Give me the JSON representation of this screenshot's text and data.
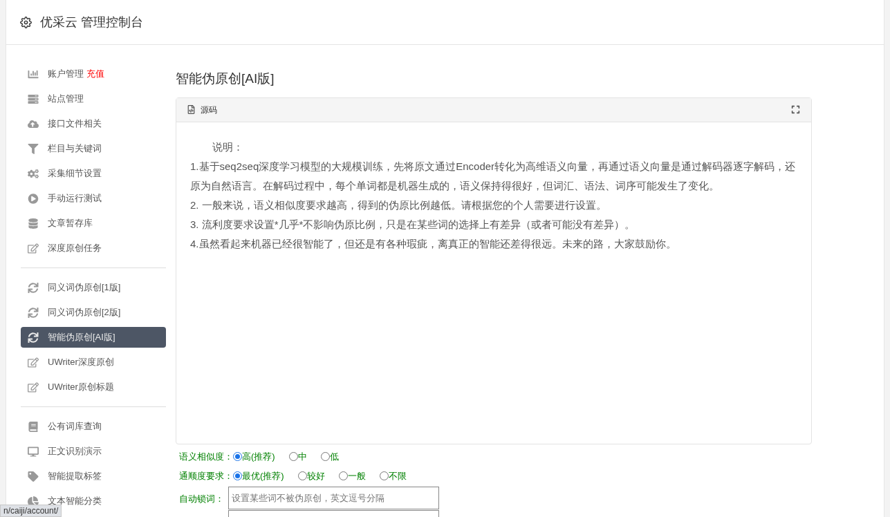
{
  "header": {
    "title": "优采云 管理控制台"
  },
  "sidebar": {
    "groups": [
      {
        "items": [
          {
            "label": "账户管理",
            "badge": "充值",
            "selected": false
          },
          {
            "label": "站点管理",
            "selected": false
          },
          {
            "label": "接口文件相关",
            "selected": false
          },
          {
            "label": "栏目与关键词",
            "selected": false
          },
          {
            "label": "采集细节设置",
            "selected": false
          },
          {
            "label": "手动运行测试",
            "selected": false
          },
          {
            "label": "文章暂存库",
            "selected": false
          },
          {
            "label": "深度原创任务",
            "selected": false
          }
        ]
      },
      {
        "items": [
          {
            "label": "同义词伪原创[1版]",
            "selected": false
          },
          {
            "label": "同义词伪原创[2版]",
            "selected": false
          },
          {
            "label": "智能伪原创[AI版]",
            "selected": true
          },
          {
            "label": "UWriter深度原创",
            "selected": false
          },
          {
            "label": "UWriter原创标题",
            "selected": false
          }
        ]
      },
      {
        "items": [
          {
            "label": "公有词库查询",
            "selected": false
          },
          {
            "label": "正文识别演示",
            "selected": false
          },
          {
            "label": "智能提取标签",
            "selected": false
          },
          {
            "label": "文本智能分类",
            "selected": false
          }
        ]
      }
    ]
  },
  "main": {
    "title": "智能伪原创[AI版]",
    "card": {
      "tab": "源码",
      "heading": "说明：",
      "notes": [
        "1.基于seq2seq深度学习模型的大规模训练，先将原文通过Encoder转化为高维语义向量，再通过语义向量是通过解码器逐字解码，还原为自然语言。在解码过程中，每个单词都是机器生成的，语义保持得很好，但词汇、语法、词序可能发生了变化。",
        "2. 一般来说，语义相似度要求越高，得到的伪原比例越低。请根据您的个人需要进行设置。",
        "3. 流利度要求设置*几乎*不影响伪原比例，只是在某些词的选择上有差异（或者可能没有差异）。",
        "4.虽然看起来机器已经很智能了，但还是有各种瑕疵，离真正的智能还差得很远。未来的路，大家鼓励你。"
      ]
    },
    "form": [
      {
        "kind": "radio",
        "label": "语义相似度：",
        "options": [
          {
            "label": "高(推荐)",
            "selected": true
          },
          {
            "label": "中",
            "selected": false
          },
          {
            "label": "低",
            "selected": false
          }
        ]
      },
      {
        "kind": "radio",
        "label": "通顺度要求：",
        "options": [
          {
            "label": "最优(推荐)",
            "selected": true
          },
          {
            "label": "较好",
            "selected": false
          },
          {
            "label": "一般",
            "selected": false
          },
          {
            "label": "不限",
            "selected": false
          }
        ]
      },
      {
        "kind": "text",
        "label": "自动锁词：",
        "placeholder": "设置某些词不被伪原创，英文逗号分隔"
      },
      {
        "kind": "text"
      }
    ]
  },
  "status_url": "n/caiji/account/"
}
